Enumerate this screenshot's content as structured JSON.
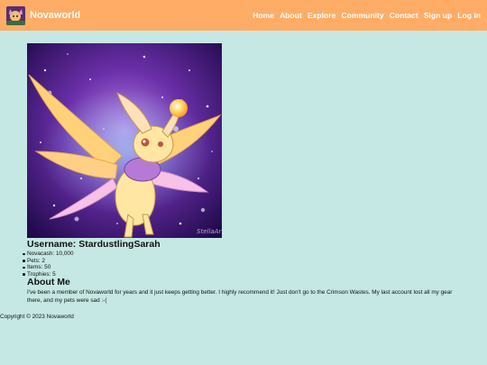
{
  "brand": {
    "name": "Novaworld"
  },
  "nav": {
    "items": [
      {
        "label": "Home"
      },
      {
        "label": "About"
      },
      {
        "label": "Explore"
      },
      {
        "label": "Community"
      },
      {
        "label": "Contact"
      },
      {
        "label": "Sign up"
      },
      {
        "label": "Log in"
      }
    ]
  },
  "profile": {
    "image_signature": "StellaArts",
    "username_label": "Username: StardustlingSarah",
    "stats": [
      {
        "text": "Novacash: 10,000"
      },
      {
        "text": "Pets: 2"
      },
      {
        "text": "Items: 50"
      },
      {
        "text": "Trophies: 5"
      }
    ],
    "about_title": "About Me",
    "about_text": "I've been a member of Novaworld for years and it just keeps getting better. I highly recommend it! Just don't go to the Crimson Wastes. My last account lost all my gear there, and my pets were sad :-("
  },
  "footer": {
    "text": "Copyright © 2023 Novaworld"
  },
  "colors": {
    "navbar": "#ffac66",
    "background": "#c5e8e4",
    "nav_text": "#ffffff"
  }
}
